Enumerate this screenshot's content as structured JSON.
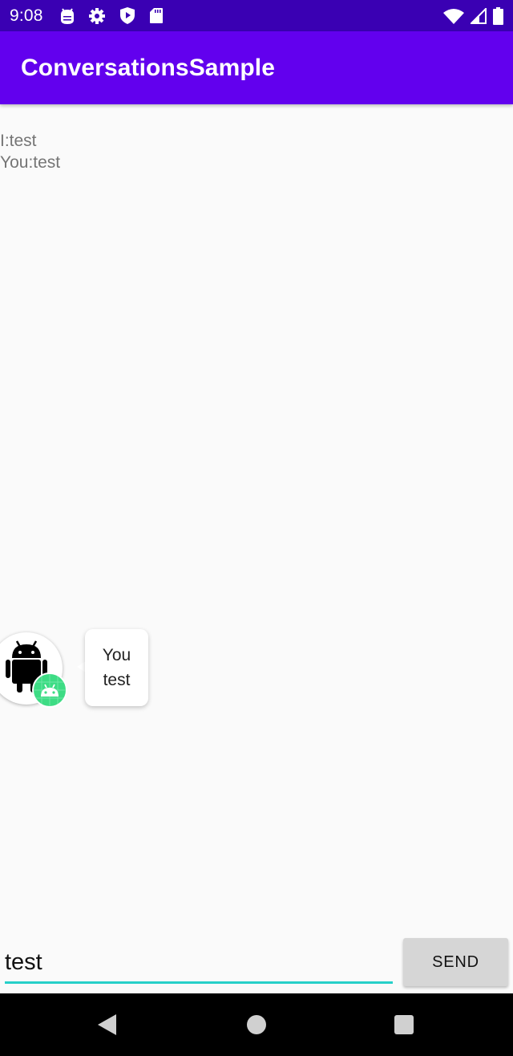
{
  "status_bar": {
    "time": "9:08",
    "left_icons": [
      "android-debug-icon",
      "settings-gear-icon",
      "shield-play-icon",
      "sd-card-icon"
    ],
    "right_icons": [
      "wifi-icon",
      "signal-icon",
      "battery-icon"
    ]
  },
  "app_bar": {
    "title": "ConversationsSample",
    "background": "#6200ee"
  },
  "conversation": {
    "lines": [
      "I:test",
      "You:test"
    ]
  },
  "bubble": {
    "title": "You",
    "message": "test",
    "avatar_icon": "android-robot-icon",
    "badge_icon": "android-head-badge-icon"
  },
  "composer": {
    "input_value": "test",
    "send_label": "SEND",
    "accent": "#26d0c9"
  },
  "nav_bar": {
    "icons": [
      "back-triangle-icon",
      "home-circle-icon",
      "recents-square-icon"
    ]
  }
}
